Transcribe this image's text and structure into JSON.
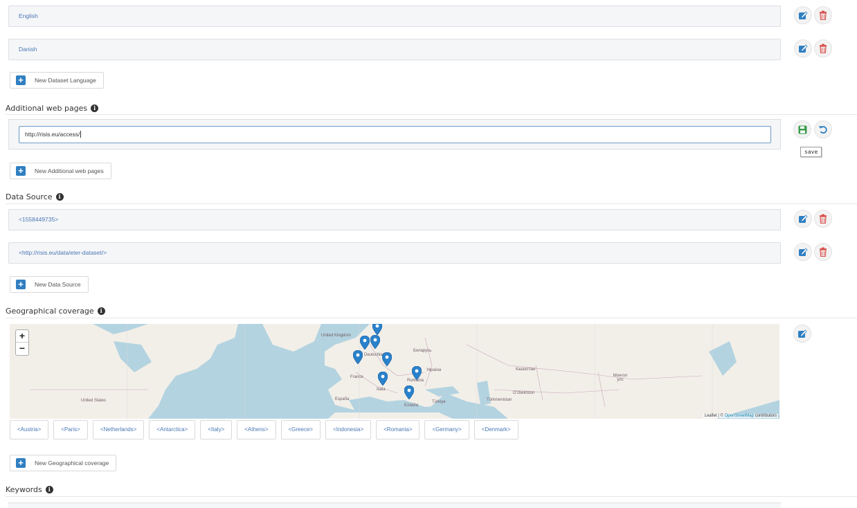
{
  "languages": {
    "items": [
      {
        "label": "English"
      },
      {
        "label": "Danish"
      }
    ],
    "add_label": "New Dataset Language"
  },
  "web_pages": {
    "title": "Additional web pages",
    "input_value": "http://risis.eu/access/",
    "tooltip": "save",
    "add_label": "New Additional web pages"
  },
  "data_source": {
    "title": "Data Source",
    "items": [
      {
        "label": "<1558449735>"
      },
      {
        "label": "<http://risis.eu/data/eter-dataset/>"
      }
    ],
    "add_label": "New Data Source"
  },
  "geo": {
    "title": "Geographical coverage",
    "zoom_in": "+",
    "zoom_out": "−",
    "attribution_prefix": "Leaflet | © ",
    "attribution_link": "OpenStreetMap",
    "attribution_suffix": " contributors",
    "map_labels": {
      "united_states": "United States",
      "united_kingdom": "United Kingdom",
      "deutschland": "Deutschland",
      "belarus": "Беларусь",
      "ukraine": "Україна",
      "kazakhstan": "Казахстан",
      "mongolia": "Монгол улс",
      "france": "France",
      "espana": "España",
      "italia": "Italia",
      "romania": "România",
      "turkiye": "Türkiye",
      "ellada": "Ελλάδα",
      "uzbekistan": "O'zbekiston",
      "turkmenistan": "Türkmenistan"
    },
    "tags": [
      "<Austria>",
      "<Paris>",
      "<Netherlands>",
      "<Antarctica>",
      "<Italy>",
      "<Athens>",
      "<Greece>",
      "<Indonesia>",
      "<Romania>",
      "<Germany>",
      "<Denmark>"
    ],
    "add_label": "New Geographical coverage"
  },
  "keywords": {
    "title": "Keywords"
  },
  "colors": {
    "edit": "#2f7fc1",
    "delete": "#d9534f",
    "save": "#3a9a4b",
    "undo": "#2f7fc1",
    "marker": "#2a81cb"
  },
  "icons": {
    "edit": "edit-icon",
    "delete": "trash-icon",
    "save": "floppy-icon",
    "undo": "undo-icon",
    "add": "plus-icon",
    "info": "info-icon",
    "marker": "map-marker-icon"
  }
}
